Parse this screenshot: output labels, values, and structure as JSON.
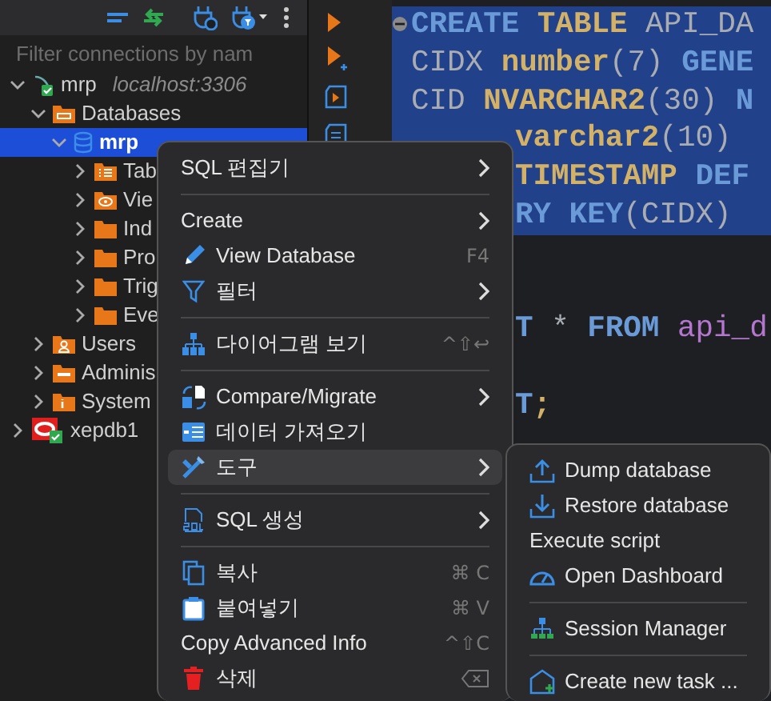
{
  "filter": {
    "placeholder": "Filter connections by nam"
  },
  "tree": [
    {
      "label": "mrp",
      "detail": "localhost:3306",
      "kind": "mysql",
      "expanded": true,
      "selected": false,
      "children": [
        {
          "label": "Databases",
          "kind": "databases",
          "expanded": true,
          "selected": false,
          "children": [
            {
              "label": "mrp",
              "kind": "database",
              "expanded": true,
              "selected": true,
              "children": [
                {
                  "label": "Tab",
                  "kind": "tables",
                  "expanded": false,
                  "selected": false
                },
                {
                  "label": "Vie",
                  "kind": "views",
                  "expanded": false,
                  "selected": false
                },
                {
                  "label": "Ind",
                  "kind": "folder",
                  "expanded": false,
                  "selected": false
                },
                {
                  "label": "Pro",
                  "kind": "folder",
                  "expanded": false,
                  "selected": false
                },
                {
                  "label": "Trig",
                  "kind": "folder",
                  "expanded": false,
                  "selected": false
                },
                {
                  "label": "Eve",
                  "kind": "folder",
                  "expanded": false,
                  "selected": false
                }
              ]
            }
          ]
        },
        {
          "label": "Users",
          "kind": "users",
          "expanded": false,
          "selected": false
        },
        {
          "label": "Adminis",
          "kind": "admin",
          "expanded": false,
          "selected": false
        },
        {
          "label": "System",
          "kind": "system",
          "expanded": false,
          "selected": false
        }
      ]
    },
    {
      "label": "xepdb1",
      "kind": "oracle",
      "expanded": false,
      "selected": false
    }
  ],
  "editor": {
    "lines": [
      {
        "kind": "code",
        "selected": true,
        "covered": false,
        "tokens": [
          {
            "text": "CREATE",
            "kind": "keyword"
          },
          {
            "text": "TABLE",
            "kind": "type"
          },
          {
            "text": "API_DA",
            "kind": "ident"
          }
        ]
      },
      {
        "kind": "code",
        "selected": true,
        "covered": false,
        "tokens": [
          {
            "text": "CIDX",
            "kind": "ident"
          },
          {
            "text": "number",
            "kind": "type"
          },
          {
            "text": "(7)",
            "kind": "ident",
            "joined": true
          },
          {
            "text": "GENE",
            "kind": "keyword"
          }
        ]
      },
      {
        "kind": "code",
        "selected": true,
        "covered": false,
        "tokens": [
          {
            "text": "CID",
            "kind": "ident"
          },
          {
            "text": "NVARCHAR2",
            "kind": "type"
          },
          {
            "text": "(30)",
            "kind": "ident",
            "joined": true
          },
          {
            "text": "N",
            "kind": "keyword"
          }
        ]
      },
      {
        "kind": "code",
        "selected": true,
        "covered": true,
        "tokens": [
          {
            "text": "varchar2",
            "kind": "type"
          },
          {
            "text": "(10)",
            "kind": "ident",
            "joined": true
          }
        ]
      },
      {
        "kind": "code",
        "selected": true,
        "covered": true,
        "tokens": [
          {
            "text": "TIMESTAMP",
            "kind": "type"
          },
          {
            "text": "DEF",
            "kind": "keyword"
          }
        ]
      },
      {
        "kind": "code",
        "selected": true,
        "covered": true,
        "tokens": [
          {
            "text": "RY KEY",
            "kind": "keyword"
          },
          {
            "text": "(CIDX)",
            "kind": "ident",
            "joined": true
          }
        ]
      },
      {
        "kind": "blank"
      },
      {
        "kind": "blank"
      },
      {
        "kind": "code",
        "selected": false,
        "covered": true,
        "tokens": [
          {
            "text": "T",
            "kind": "keyword"
          },
          {
            "text": "*",
            "kind": "ident"
          },
          {
            "text": "FROM",
            "kind": "keyword"
          },
          {
            "text": "api_d",
            "kind": "table"
          }
        ]
      },
      {
        "kind": "blank"
      },
      {
        "kind": "code",
        "selected": false,
        "covered": true,
        "tokens": [
          {
            "text": "T",
            "kind": "keyword"
          },
          {
            "text": ";",
            "kind": "type",
            "joined": true
          }
        ]
      }
    ]
  },
  "context_menu": {
    "items": [
      {
        "kind": "item",
        "label": "SQL 편집기",
        "submenu": true,
        "selected": false
      },
      {
        "kind": "separator"
      },
      {
        "kind": "item",
        "label": "Create",
        "submenu": true,
        "selected": false
      },
      {
        "kind": "item",
        "label": "View Database",
        "shortcut": "F4",
        "submenu": false,
        "selected": false
      },
      {
        "kind": "item",
        "label": "필터",
        "submenu": true,
        "selected": false
      },
      {
        "kind": "separator"
      },
      {
        "kind": "item",
        "label": "다이어그램 보기",
        "shortcut": "^⇧↩",
        "submenu": false,
        "selected": false
      },
      {
        "kind": "separator"
      },
      {
        "kind": "item",
        "label": "Compare/Migrate",
        "submenu": true,
        "selected": false
      },
      {
        "kind": "item",
        "label": "데이터 가져오기",
        "submenu": false,
        "selected": false
      },
      {
        "kind": "item",
        "label": "도구",
        "submenu": true,
        "selected": true
      },
      {
        "kind": "separator"
      },
      {
        "kind": "item",
        "label": "SQL 생성",
        "submenu": true,
        "selected": false
      },
      {
        "kind": "separator"
      },
      {
        "kind": "item",
        "label": "복사",
        "shortcut": "⌘ C",
        "submenu": false,
        "selected": false
      },
      {
        "kind": "item",
        "label": "붙여넣기",
        "shortcut": "⌘ V",
        "submenu": false,
        "selected": false
      },
      {
        "kind": "item",
        "label": "Copy Advanced Info",
        "shortcut": "^⇧C",
        "submenu": false,
        "selected": false
      },
      {
        "kind": "item",
        "label": "삭제",
        "submenu": false,
        "selected": false
      }
    ]
  },
  "submenu": {
    "items": [
      {
        "kind": "item",
        "label": "Dump database"
      },
      {
        "kind": "item",
        "label": "Restore database"
      },
      {
        "kind": "item",
        "label": "Execute script"
      },
      {
        "kind": "item",
        "label": "Open Dashboard"
      },
      {
        "kind": "separator"
      },
      {
        "kind": "item",
        "label": "Session Manager"
      },
      {
        "kind": "separator"
      },
      {
        "kind": "item",
        "label": "Create new task ..."
      }
    ]
  }
}
